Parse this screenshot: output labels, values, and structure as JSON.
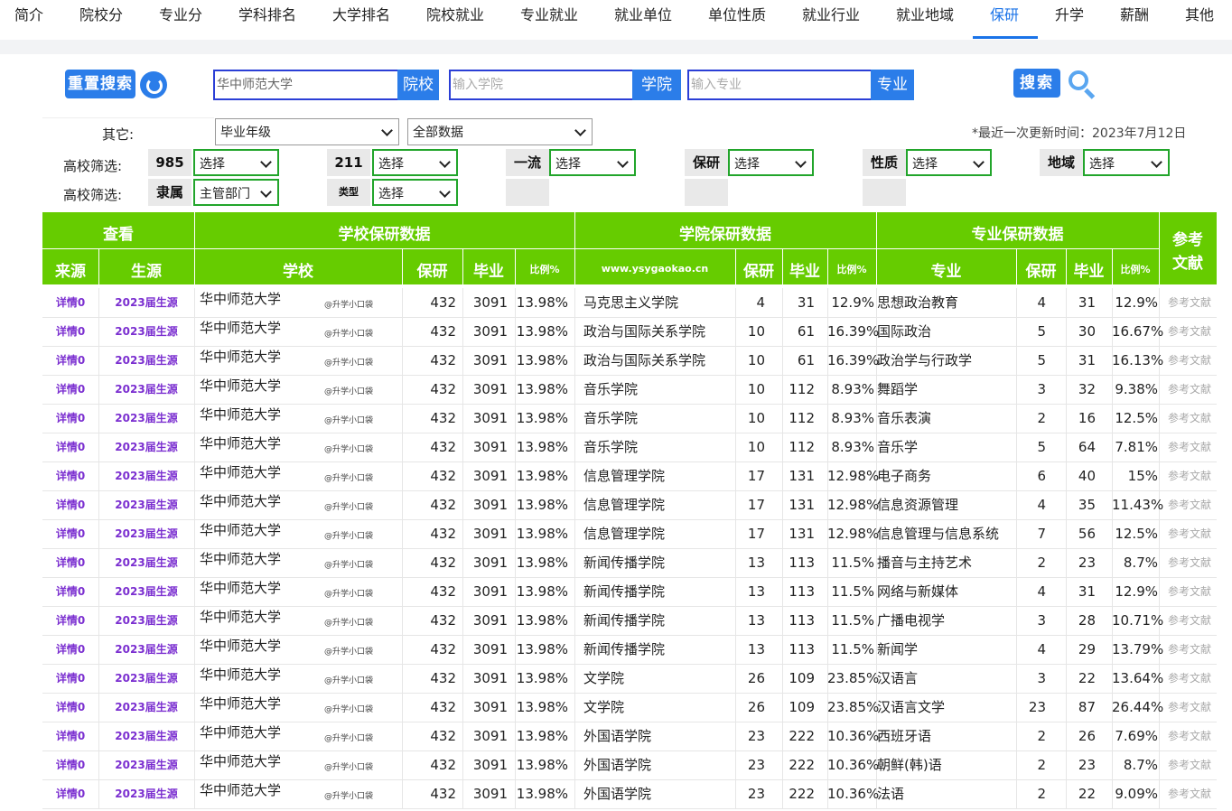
{
  "nav": {
    "tabs": [
      "简介",
      "院校分",
      "专业分",
      "学科排名",
      "大学排名",
      "院校就业",
      "专业就业",
      "就业单位",
      "单位性质",
      "就业行业",
      "就业地域",
      "保研",
      "升学",
      "薪酬",
      "其他"
    ],
    "active": "保研"
  },
  "search": {
    "reset_label": "重置搜索",
    "school_value": "华中师范大学",
    "school_btn": "院校",
    "college_placeholder": "输入学院",
    "college_btn": "学院",
    "major_placeholder": "输入专业",
    "major_btn": "专业",
    "search_label": "搜索"
  },
  "filters": {
    "other_label": "其它:",
    "grad_year": "毕业年级",
    "data_scope": "全部数据",
    "update_text": "*最近一次更新时间：2023年7月12日",
    "row1_label": "高校筛选:",
    "row2_label": "高校筛选:",
    "tags": {
      "t985": "985",
      "t211": "211",
      "first": "一流",
      "baoyan": "保研",
      "nature": "性质",
      "region": "地域",
      "affil": "隶属",
      "type": "类型"
    },
    "select_default": "选择",
    "affil_value": "主管部门"
  },
  "table": {
    "groups": {
      "view": "查看",
      "school": "学校保研数据",
      "college": "学院保研数据",
      "major": "专业保研数据",
      "ref": "参考文献"
    },
    "cols": {
      "source": "来源",
      "student": "生源",
      "school": "学校",
      "baoyan": "保研",
      "grad": "毕业",
      "ratio": "比例%",
      "site": "www.ysygaokao.cn",
      "major": "专业"
    },
    "detail_label": "详情0",
    "year_label": "2023届生源",
    "watermark": "@升学小口袋",
    "ref_label": "参考文献",
    "school_name": "华中师范大学",
    "school_baoyan": "432",
    "school_grad": "3091",
    "school_ratio": "13.98%",
    "rows": [
      {
        "college": "马克思主义学院",
        "cb": "4",
        "cg": "31",
        "cr": "12.9%",
        "major": "思想政治教育",
        "mb": "4",
        "mg": "31",
        "mr": "12.9%"
      },
      {
        "college": "政治与国际关系学院",
        "cb": "10",
        "cg": "61",
        "cr": "16.39%",
        "major": "国际政治",
        "mb": "5",
        "mg": "30",
        "mr": "16.67%"
      },
      {
        "college": "政治与国际关系学院",
        "cb": "10",
        "cg": "61",
        "cr": "16.39%",
        "major": "政治学与行政学",
        "mb": "5",
        "mg": "31",
        "mr": "16.13%"
      },
      {
        "college": "音乐学院",
        "cb": "10",
        "cg": "112",
        "cr": "8.93%",
        "major": "舞蹈学",
        "mb": "3",
        "mg": "32",
        "mr": "9.38%"
      },
      {
        "college": "音乐学院",
        "cb": "10",
        "cg": "112",
        "cr": "8.93%",
        "major": "音乐表演",
        "mb": "2",
        "mg": "16",
        "mr": "12.5%"
      },
      {
        "college": "音乐学院",
        "cb": "10",
        "cg": "112",
        "cr": "8.93%",
        "major": "音乐学",
        "mb": "5",
        "mg": "64",
        "mr": "7.81%"
      },
      {
        "college": "信息管理学院",
        "cb": "17",
        "cg": "131",
        "cr": "12.98%",
        "major": "电子商务",
        "mb": "6",
        "mg": "40",
        "mr": "15%"
      },
      {
        "college": "信息管理学院",
        "cb": "17",
        "cg": "131",
        "cr": "12.98%",
        "major": "信息资源管理",
        "mb": "4",
        "mg": "35",
        "mr": "11.43%"
      },
      {
        "college": "信息管理学院",
        "cb": "17",
        "cg": "131",
        "cr": "12.98%",
        "major": "信息管理与信息系统",
        "mb": "7",
        "mg": "56",
        "mr": "12.5%"
      },
      {
        "college": "新闻传播学院",
        "cb": "13",
        "cg": "113",
        "cr": "11.5%",
        "major": "播音与主持艺术",
        "mb": "2",
        "mg": "23",
        "mr": "8.7%"
      },
      {
        "college": "新闻传播学院",
        "cb": "13",
        "cg": "113",
        "cr": "11.5%",
        "major": "网络与新媒体",
        "mb": "4",
        "mg": "31",
        "mr": "12.9%"
      },
      {
        "college": "新闻传播学院",
        "cb": "13",
        "cg": "113",
        "cr": "11.5%",
        "major": "广播电视学",
        "mb": "3",
        "mg": "28",
        "mr": "10.71%"
      },
      {
        "college": "新闻传播学院",
        "cb": "13",
        "cg": "113",
        "cr": "11.5%",
        "major": "新闻学",
        "mb": "4",
        "mg": "29",
        "mr": "13.79%"
      },
      {
        "college": "文学院",
        "cb": "26",
        "cg": "109",
        "cr": "23.85%",
        "major": "汉语言",
        "mb": "3",
        "mg": "22",
        "mr": "13.64%"
      },
      {
        "college": "文学院",
        "cb": "26",
        "cg": "109",
        "cr": "23.85%",
        "major": "汉语言文学",
        "mb": "23",
        "mg": "87",
        "mr": "26.44%"
      },
      {
        "college": "外国语学院",
        "cb": "23",
        "cg": "222",
        "cr": "10.36%",
        "major": "西班牙语",
        "mb": "2",
        "mg": "26",
        "mr": "7.69%"
      },
      {
        "college": "外国语学院",
        "cb": "23",
        "cg": "222",
        "cr": "10.36%",
        "major": "朝鲜(韩)语",
        "mb": "2",
        "mg": "23",
        "mr": "8.7%"
      },
      {
        "college": "外国语学院",
        "cb": "23",
        "cg": "222",
        "cr": "10.36%",
        "major": "法语",
        "mb": "2",
        "mg": "22",
        "mr": "9.09%"
      }
    ]
  }
}
